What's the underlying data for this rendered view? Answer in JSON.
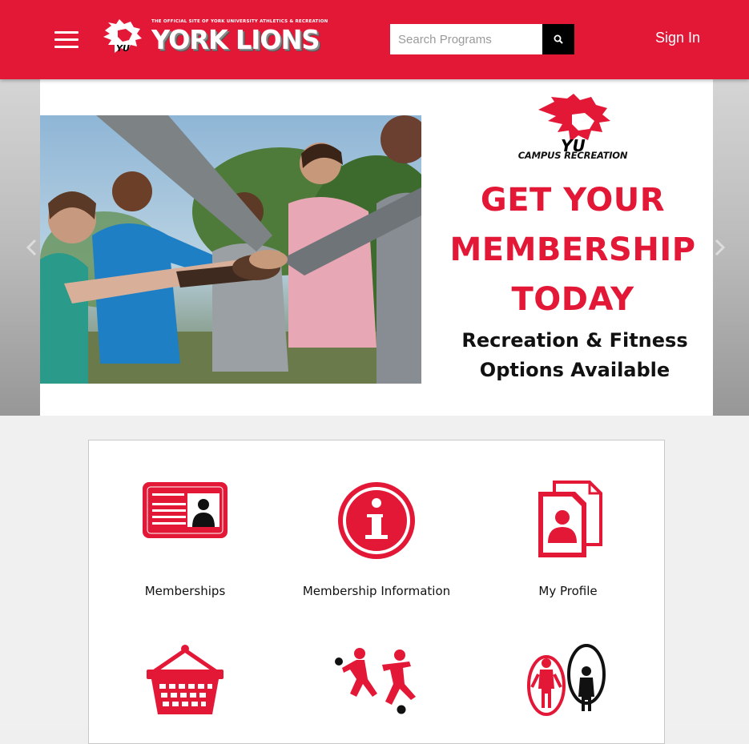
{
  "header": {
    "logo_tagline": "THE OFFICIAL SITE OF YORK UNIVERSITY ATHLETICS & RECREATION",
    "logo_text": "YORK LIONS",
    "search_placeholder": "Search Programs",
    "sign_in": "Sign In"
  },
  "carousel": {
    "brand": "CAMPUS RECREATION",
    "brand_mark": "YU",
    "headline": [
      "GET YOUR",
      "MEMBERSHIP",
      "TODAY"
    ],
    "subline": [
      "Recreation & Fitness",
      "Options Available"
    ]
  },
  "tiles": [
    {
      "label": "Memberships",
      "icon": "id-card-icon"
    },
    {
      "label": "Membership Information",
      "icon": "info-icon"
    },
    {
      "label": "My Profile",
      "icon": "profile-document-icon"
    },
    {
      "label": "",
      "icon": "shopping-basket-icon"
    },
    {
      "label": "",
      "icon": "soccer-players-icon"
    },
    {
      "label": "",
      "icon": "jump-rope-icon"
    }
  ],
  "colors": {
    "brand_red": "#e31837",
    "black": "#000000",
    "white": "#ffffff"
  }
}
